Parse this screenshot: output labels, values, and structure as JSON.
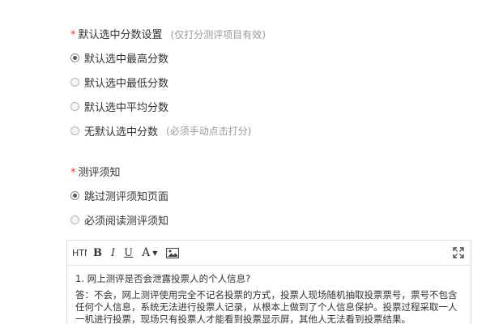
{
  "score_setting": {
    "required_mark": "*",
    "label": "默认选中分数设置",
    "hint": "(仅打分测评项目有效)",
    "options": [
      {
        "label": "默认选中最高分数",
        "checked": true
      },
      {
        "label": "默认选中最低分数",
        "checked": false
      },
      {
        "label": "默认选中平均分数",
        "checked": false
      },
      {
        "label": "无默认选中分数",
        "checked": false,
        "hint": "(必须手动点击打分)"
      }
    ]
  },
  "notice_setting": {
    "required_mark": "*",
    "label": "测评须知",
    "options": [
      {
        "label": "跳过测评须知页面",
        "checked": true
      },
      {
        "label": "必须阅读测评须知",
        "checked": false
      }
    ]
  },
  "editor": {
    "toolbar": {
      "html": "HTML",
      "bold": "B",
      "italic": "I",
      "underline": "U",
      "font": "A",
      "font_caret": "▼"
    },
    "content": {
      "question": "1. 网上测评是否会泄露投票人的个人信息?",
      "answer": "答：不会，网上测评使用完全不记名投票的方式，投票人现场随机抽取投票票号，票号不包含任何个人信息，系统无法进行投票人记录，从根本上做到了个人信息保护。投票过程采取一人一机进行投票，现场只有投票人才能看到投票显示屏，其他人无法看到投票结果。"
    }
  },
  "icons": {
    "radio": "radio-button",
    "image": "image-icon",
    "fullscreen": "fullscreen-icon"
  }
}
